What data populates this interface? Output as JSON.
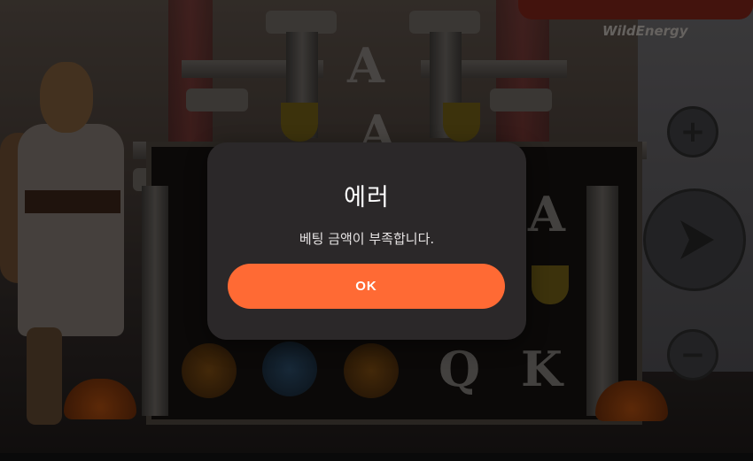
{
  "game": {
    "logo_subtitle": "WildEnergy",
    "reel_symbols": [
      "A",
      "A",
      "A",
      "Q",
      "K"
    ],
    "controls": {
      "plus_icon": "plus-icon",
      "spin_icon": "spin-icon",
      "minus_icon": "minus-icon"
    }
  },
  "dialog": {
    "title": "에러",
    "message": "베팅 금액이 부족합니다.",
    "ok_label": "OK"
  },
  "colors": {
    "dialog_bg": "#2b2829",
    "ok_button": "#ff6a34",
    "title_text": "#ffffff"
  }
}
